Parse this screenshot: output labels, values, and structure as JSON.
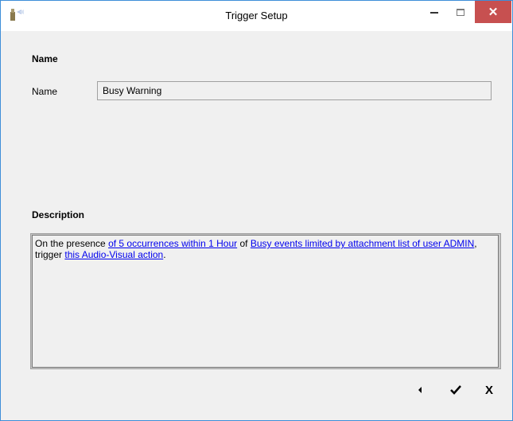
{
  "window": {
    "title": "Trigger Setup",
    "close_glyph": "✕"
  },
  "name_section": {
    "heading": "Name",
    "label": "Name",
    "value": "Busy Warning"
  },
  "description_section": {
    "heading": "Description",
    "text_1": "On the presence ",
    "link_1": "of 5 occurrences within 1 Hour",
    "text_2": " of ",
    "link_2": "Busy events limited by attachment list of user ADMIN",
    "text_3": ", trigger ",
    "link_3": "this Audio-Visual action",
    "text_4": "."
  },
  "footer": {
    "cancel_label": "X"
  },
  "colors": {
    "link": "#0000ee",
    "close_button": "#c75050",
    "window_border": "#3e8ed8"
  },
  "icons": {
    "app": "beacon-icon",
    "back": "back-arrow-icon",
    "ok": "checkmark-icon",
    "cancel": "x-icon"
  }
}
